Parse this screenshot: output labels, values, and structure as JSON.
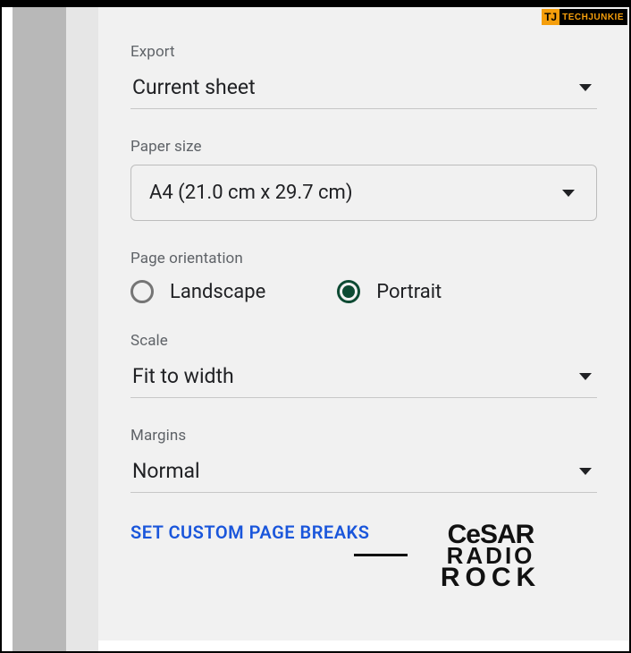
{
  "watermarks": {
    "techjunkie_short": "TJ",
    "techjunkie_text": "TECHJUNKIE",
    "cesar_l1": "CeSAR",
    "cesar_l2": "RADIO",
    "cesar_l3": "ROCK"
  },
  "export": {
    "label": "Export",
    "value": "Current sheet"
  },
  "paper_size": {
    "label": "Paper size",
    "value": "A4 (21.0 cm x 29.7 cm)"
  },
  "orientation": {
    "label": "Page orientation",
    "options": [
      {
        "label": "Landscape",
        "selected": false
      },
      {
        "label": "Portrait",
        "selected": true
      }
    ]
  },
  "scale": {
    "label": "Scale",
    "value": "Fit to width"
  },
  "margins": {
    "label": "Margins",
    "value": "Normal"
  },
  "custom_breaks": {
    "label": "SET CUSTOM PAGE BREAKS"
  }
}
